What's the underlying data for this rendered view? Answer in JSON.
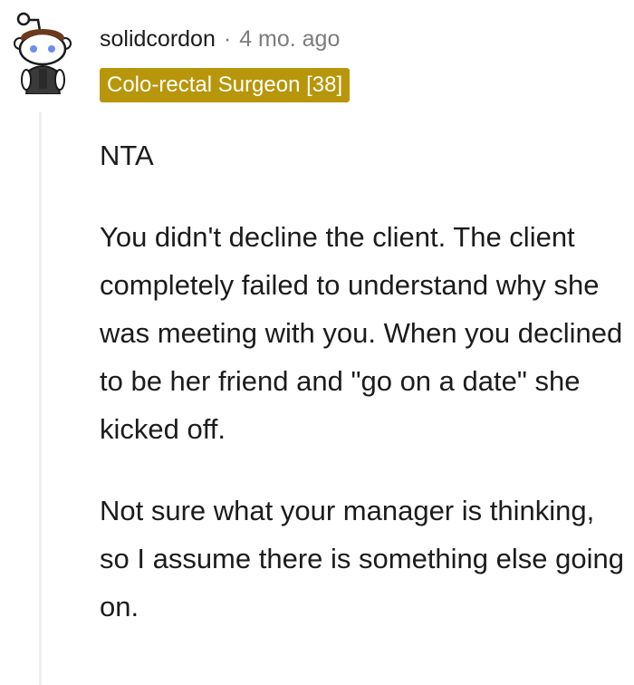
{
  "comment": {
    "author": "solidcordon",
    "separator": "·",
    "timestamp": "4 mo. ago",
    "flair": "Colo-rectal Surgeon [38]",
    "avatar_icon": "reddit-snoo-avatar-icon",
    "paragraphs": [
      "NTA",
      "You didn't decline the client. The client completely failed to understand why she was meeting with you. When you declined to be her friend and \"go on a date\" she kicked off.",
      "Not sure what your manager is thinking, so I assume there is something else going on."
    ]
  },
  "colors": {
    "flair_background": "#b8960b",
    "flair_text": "#ffffff",
    "meta_gray": "#7c7c7c",
    "thread_line": "#edeff1"
  }
}
